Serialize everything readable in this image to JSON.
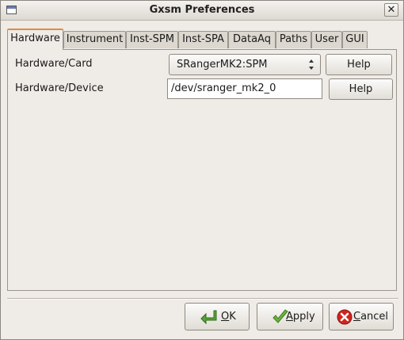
{
  "window": {
    "title": "Gxsm Preferences",
    "close_glyph": "✕"
  },
  "tabs": [
    {
      "label": "Hardware",
      "active": true
    },
    {
      "label": "Instrument"
    },
    {
      "label": "Inst-SPM"
    },
    {
      "label": "Inst-SPA"
    },
    {
      "label": "DataAq"
    },
    {
      "label": "Paths"
    },
    {
      "label": "User"
    },
    {
      "label": "GUI"
    }
  ],
  "hardware": {
    "card_label": "Hardware/Card",
    "card_value": "SRangerMK2:SPM",
    "device_label": "Hardware/Device",
    "device_value": "/dev/sranger_mk2_0",
    "help_label": "Help"
  },
  "buttons": {
    "ok": {
      "mnemonic": "O",
      "rest": "K",
      "icon": "green-arrow-icon"
    },
    "apply": {
      "mnemonic": "A",
      "rest": "pply",
      "icon": "checkmark-icon"
    },
    "cancel": {
      "mnemonic": "C",
      "rest": "ancel",
      "icon": "cancel-icon"
    }
  },
  "colors": {
    "active_tab_accent": "#e08b3c",
    "ok_icon": "#5aa33a",
    "cancel_icon": "#d0251f"
  }
}
